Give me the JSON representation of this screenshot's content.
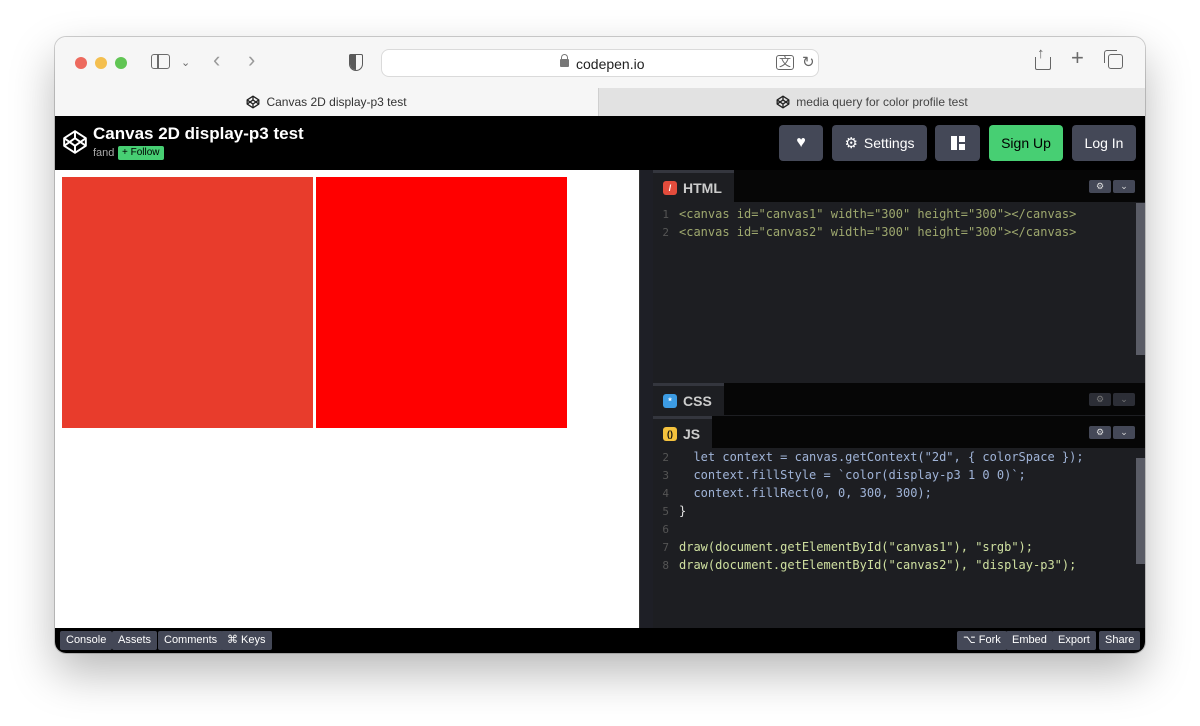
{
  "browser": {
    "url": "codepen.io",
    "tabs": [
      {
        "label": "Canvas 2D display-p3 test",
        "active": true
      },
      {
        "label": "media query for color profile test",
        "active": false
      }
    ]
  },
  "header": {
    "title": "Canvas 2D display-p3 test",
    "author": "fand",
    "follow_label": "+ Follow",
    "settings_label": "Settings",
    "signup_label": "Sign Up",
    "login_label": "Log In"
  },
  "preview": {
    "canvas1_color": "#e83c2c",
    "canvas2_color": "#ff0000"
  },
  "editors": {
    "html": {
      "title": "HTML",
      "badge": "/",
      "lines": [
        {
          "n": "1",
          "text": "<canvas id=\"canvas1\" width=\"300\" height=\"300\"></canvas>"
        },
        {
          "n": "2",
          "text": "<canvas id=\"canvas2\" width=\"300\" height=\"300\"></canvas>"
        }
      ]
    },
    "css": {
      "title": "CSS",
      "badge": "*"
    },
    "js": {
      "title": "JS",
      "badge": "()",
      "lines": [
        {
          "n": "2",
          "text": "  let context = canvas.getContext(\"2d\", { colorSpace });"
        },
        {
          "n": "3",
          "text": "  context.fillStyle = `color(display-p3 1 0 0)`;"
        },
        {
          "n": "4",
          "text": "  context.fillRect(0, 0, 300, 300);"
        },
        {
          "n": "5",
          "text": "}"
        },
        {
          "n": "6",
          "text": ""
        },
        {
          "n": "7",
          "text": "draw(document.getElementById(\"canvas1\"), \"srgb\");"
        },
        {
          "n": "8",
          "text": "draw(document.getElementById(\"canvas2\"), \"display-p3\");"
        }
      ]
    }
  },
  "footer": {
    "left": [
      "Console",
      "Assets",
      "Comments",
      "⌘ Keys"
    ],
    "right": [
      "⌥ Fork",
      "Embed",
      "Export",
      "Share"
    ]
  }
}
